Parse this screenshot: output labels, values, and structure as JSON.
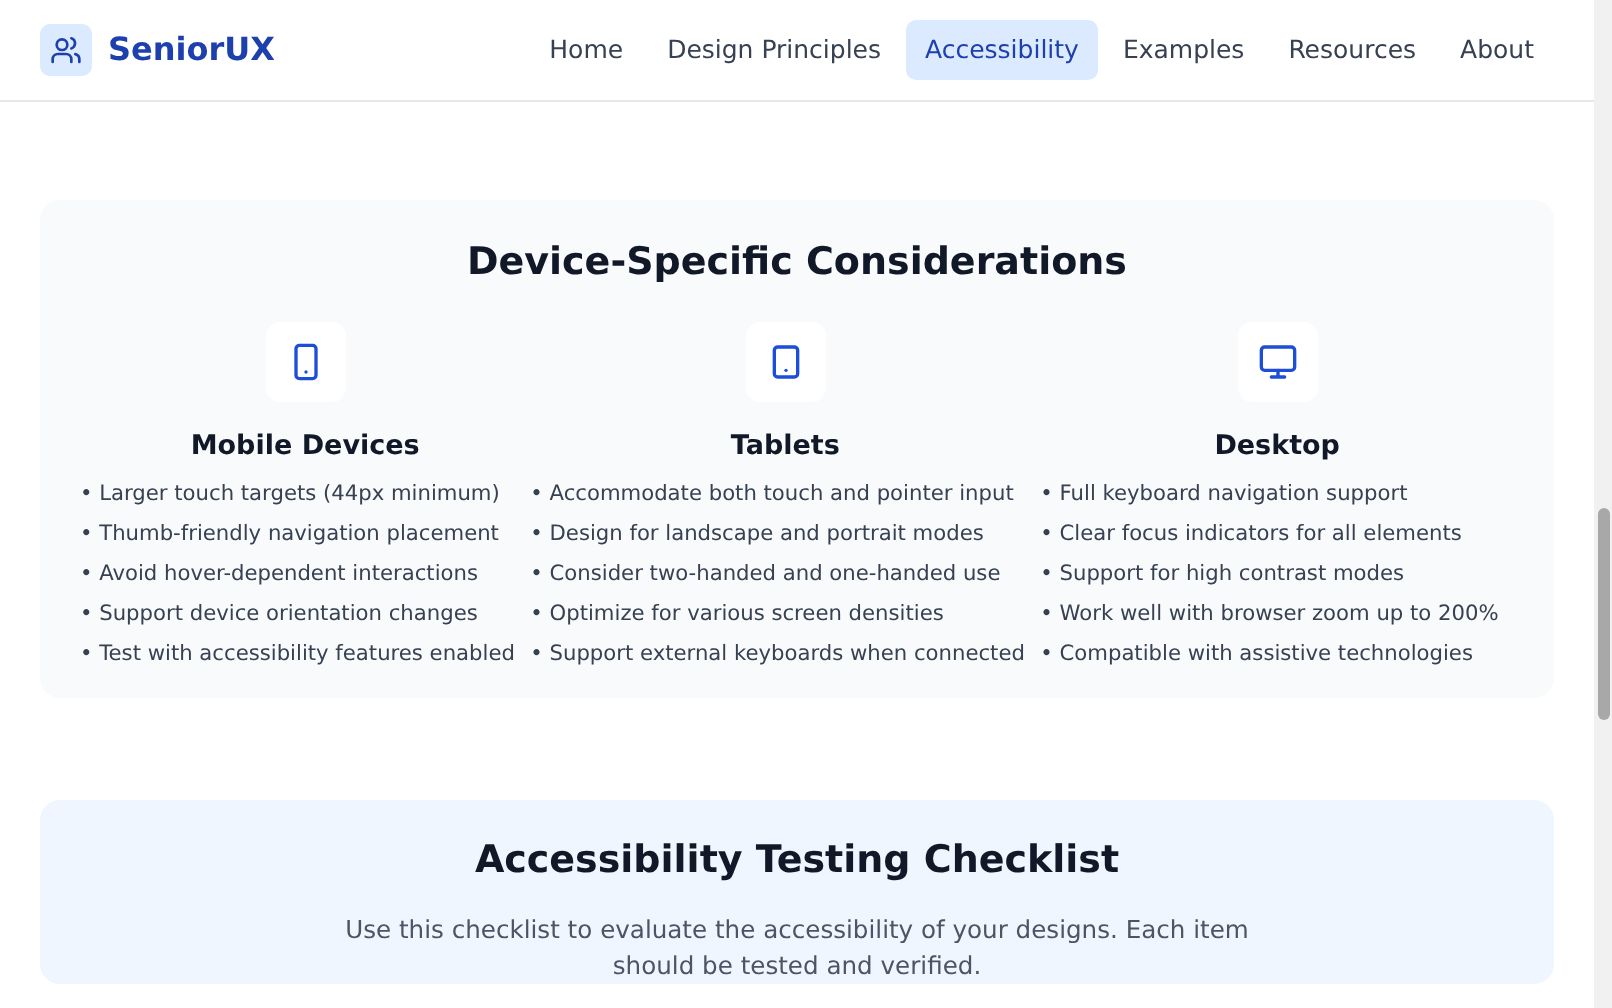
{
  "brand": {
    "name": "SeniorUX"
  },
  "nav": [
    {
      "label": "Home",
      "selected": false
    },
    {
      "label": "Design Principles",
      "selected": false
    },
    {
      "label": "Accessibility",
      "selected": true
    },
    {
      "label": "Examples",
      "selected": false
    },
    {
      "label": "Resources",
      "selected": false
    },
    {
      "label": "About",
      "selected": false
    }
  ],
  "considerations": {
    "title": "Device-Specific Considerations",
    "devices": [
      {
        "kind": "phone",
        "name": "Mobile Devices",
        "items": [
          "• Larger touch targets (44px minimum)",
          "• Thumb-friendly navigation placement",
          "• Avoid hover-dependent interactions",
          "• Support device orientation changes",
          "• Test with accessibility features enabled"
        ]
      },
      {
        "kind": "tablet",
        "name": "Tablets",
        "items": [
          "• Accommodate both touch and pointer input",
          "• Design for landscape and portrait modes",
          "• Consider two-handed and one-handed use",
          "• Optimize for various screen densities",
          "• Support external keyboards when connected"
        ]
      },
      {
        "kind": "monitor",
        "name": "Desktop",
        "items": [
          "• Full keyboard navigation support",
          "• Clear focus indicators for all elements",
          "• Support for high contrast modes",
          "• Work well with browser zoom up to 200%",
          "• Compatible with assistive technologies"
        ]
      }
    ]
  },
  "checklist": {
    "title": "Accessibility Testing Checklist",
    "intro": "Use this checklist to evaluate the accessibility of your designs. Each item should be tested and verified."
  }
}
